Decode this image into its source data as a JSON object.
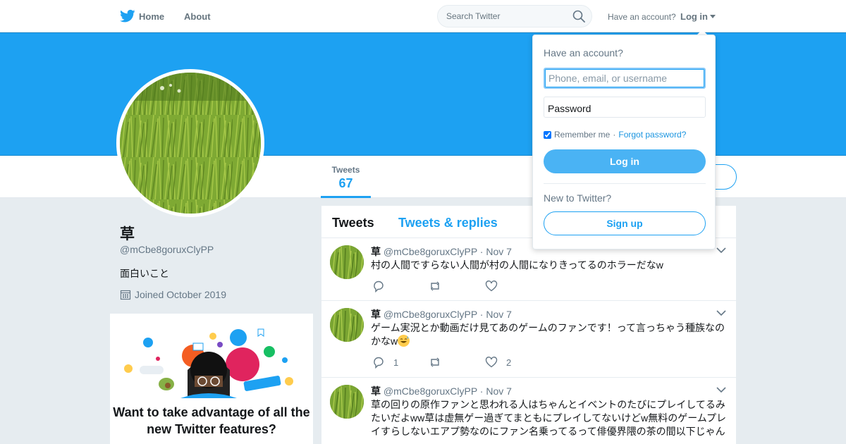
{
  "topnav": {
    "home_label": "Home",
    "about_label": "About",
    "search_placeholder": "Search Twitter",
    "have_account": "Have an account?",
    "login_label": "Log in"
  },
  "profile": {
    "stats": [
      {
        "label": "Tweets",
        "value": "67"
      }
    ],
    "name": "草",
    "handle": "@mCbe8goruxClyPP",
    "bio": "面白いこと",
    "joined": "Joined October 2019"
  },
  "promo": {
    "title": "Want to take advantage of all the new Twitter features?"
  },
  "timeline": {
    "tabs": [
      "Tweets",
      "Tweets & replies"
    ],
    "tweets": [
      {
        "name": "草",
        "handle": "@mCbe8goruxClyPP",
        "date": "Nov 7",
        "text": "村の人間ですらない人間が村の人間になりきってるのホラーだなw",
        "replies": "",
        "retweets": "",
        "likes": ""
      },
      {
        "name": "草",
        "handle": "@mCbe8goruxClyPP",
        "date": "Nov 7",
        "text": "ゲーム実況とか動画だけ見てあのゲームのファンです！って言っちゃう種族なのかなw",
        "replies": "1",
        "retweets": "",
        "likes": "2"
      },
      {
        "name": "草",
        "handle": "@mCbe8goruxClyPP",
        "date": "Nov 7",
        "text": "草の回りの原作ファンと思われる人はちゃんとイベントのたびにプレイしてるみたいだよww草は虚無ゲー過ぎてまともにプレイしてないけどw無料のゲームプレイすらしないエアプ勢なのにファン名乗ってるって俳優界隈の茶の間以下じゃん",
        "replies": "",
        "retweets": "",
        "likes": ""
      }
    ]
  },
  "login_dropdown": {
    "title": "Have an account?",
    "username_placeholder": "Phone, email, or username",
    "password_placeholder": "Password",
    "remember_label": "Remember me",
    "separator": "·",
    "forgot_label": "Forgot password?",
    "login_button": "Log in",
    "new_label": "New to Twitter?",
    "signup_button": "Sign up"
  },
  "colors": {
    "brand_blue": "#1da1f2",
    "banner": "#1da1f2",
    "login_button": "#4ab3f4"
  },
  "icons": [
    "twitter-bird-icon",
    "search-icon",
    "calendar-icon",
    "reply-icon",
    "retweet-icon",
    "like-icon",
    "chevron-down-icon",
    "grin-sweat-emoji-icon"
  ]
}
